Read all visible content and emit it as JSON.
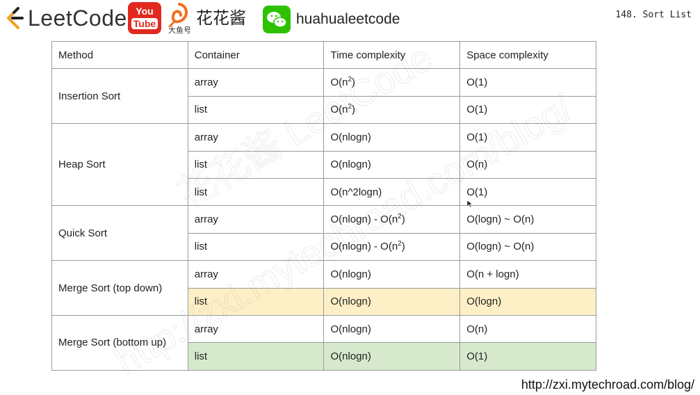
{
  "header": {
    "brand": "LeetCode",
    "youtube_top": "You",
    "youtube_bottom": "Tube",
    "platform_label": "大鱼号",
    "author": "花花酱",
    "wechat_id": "huahualeetcode",
    "slide_title": "148. Sort List"
  },
  "table": {
    "headers": {
      "method": "Method",
      "container": "Container",
      "time": "Time complexity",
      "space": "Space complexity"
    },
    "groups": [
      {
        "method": "Insertion Sort",
        "rows": [
          {
            "container": "array",
            "time_base": "O(n",
            "time_sup": "2",
            "time_tail": ")",
            "space": "O(1)"
          },
          {
            "container": "list",
            "time_base": "O(n",
            "time_sup": "2",
            "time_tail": ")",
            "space": "O(1)"
          }
        ]
      },
      {
        "method": "Heap Sort",
        "rows": [
          {
            "container": "array",
            "time": "O(nlogn)",
            "space": "O(1)"
          },
          {
            "container": "list",
            "time": "O(nlogn)",
            "space": "O(n)"
          },
          {
            "container": "list",
            "time": "O(n^2logn)",
            "space": "O(1)"
          }
        ]
      },
      {
        "method": "Quick Sort",
        "rows": [
          {
            "container": "array",
            "time_base": "O(nlogn) - O(n",
            "time_sup": "2",
            "time_tail": ")",
            "space": "O(logn) ~ O(n)"
          },
          {
            "container": "list",
            "time_base": "O(nlogn) - O(n",
            "time_sup": "2",
            "time_tail": ")",
            "space": "O(logn) ~ O(n)"
          }
        ]
      },
      {
        "method": "Merge Sort (top down)",
        "rows": [
          {
            "container": "array",
            "time": "O(nlogn)",
            "space": "O(n + logn)"
          },
          {
            "container": "list",
            "time": "O(nlogn)",
            "space": "O(logn)",
            "highlight": "#fef0c6"
          }
        ]
      },
      {
        "method": "Merge Sort (bottom up)",
        "rows": [
          {
            "container": "array",
            "time": "O(nlogn)",
            "space": "O(n)"
          },
          {
            "container": "list",
            "time": "O(nlogn)",
            "space": "O(1)",
            "highlight": "#d6e9cd"
          }
        ]
      }
    ]
  },
  "watermark": {
    "line1": "花花酱 LeetCode",
    "line2": "http://zxi.mytechroad.com/blog/"
  },
  "footer": {
    "url": "http://zxi.mytechroad.com/blog/"
  },
  "colors": {
    "youtube_red": "#e02a20",
    "wechat_green": "#2dc100",
    "row_yellow": "#fef0c6",
    "row_green": "#d6e9cd",
    "border": "#9a9a9a"
  }
}
